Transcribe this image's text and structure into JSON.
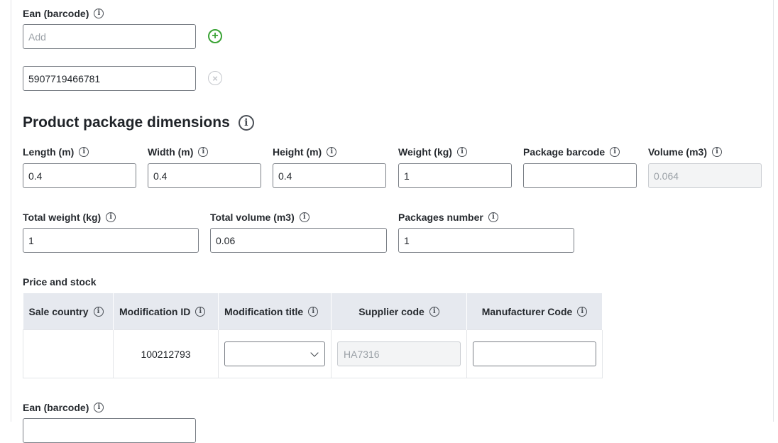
{
  "ean_section": {
    "label": "Ean (barcode)",
    "add_placeholder": "Add",
    "existing_value": "5907719466781",
    "add_symbol": "+",
    "remove_symbol": "×"
  },
  "dimensions": {
    "title": "Product package dimensions",
    "length": {
      "label": "Length (m)",
      "value": "0.4"
    },
    "width": {
      "label": "Width (m)",
      "value": "0.4"
    },
    "height": {
      "label": "Height (m)",
      "value": "0.4"
    },
    "weight": {
      "label": "Weight (kg)",
      "value": "1"
    },
    "package_barcode": {
      "label": "Package barcode",
      "value": ""
    },
    "volume": {
      "label": "Volume (m3)",
      "value": "0.064"
    },
    "total_weight": {
      "label": "Total weight (kg)",
      "value": "1"
    },
    "total_volume": {
      "label": "Total volume (m3)",
      "value": "0.06"
    },
    "packages_number": {
      "label": "Packages number",
      "value": "1"
    }
  },
  "price_stock": {
    "title": "Price and stock",
    "columns": [
      "Sale country",
      "Modification ID",
      "Modification title",
      "Supplier code",
      "Manufacturer Code"
    ],
    "row": {
      "sale_country": "",
      "modification_id": "100212793",
      "modification_title": "",
      "supplier_code": "HA7316",
      "manufacturer_code": ""
    }
  },
  "ean_section_2": {
    "label": "Ean (barcode)"
  },
  "info_glyph": "i",
  "colors": {
    "accent_green": "#3aa335",
    "header_bg": "#e6e9ef",
    "border": "#7a7f86"
  }
}
